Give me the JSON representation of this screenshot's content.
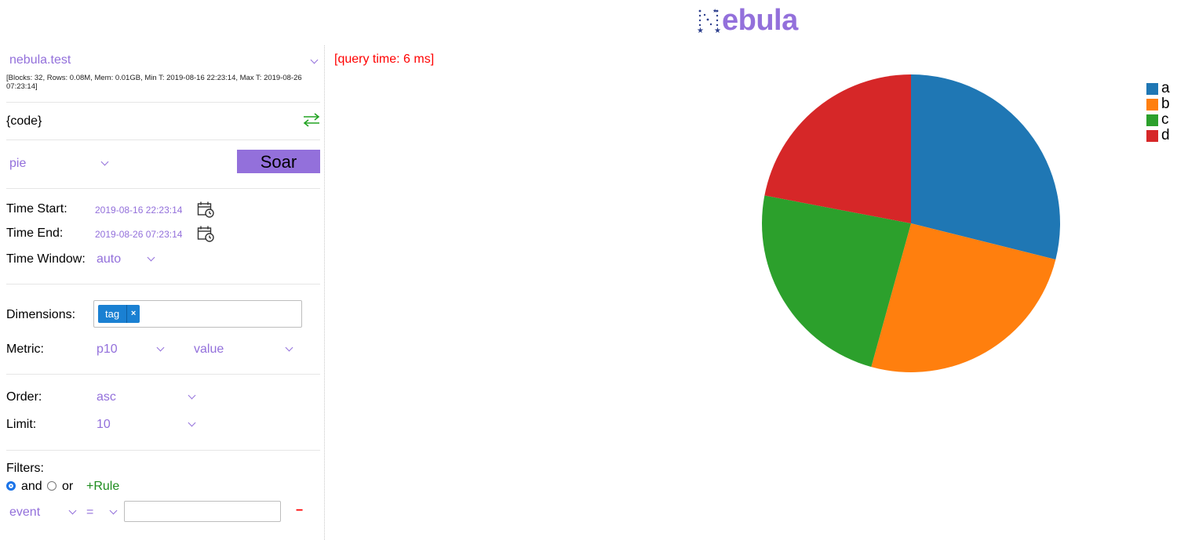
{
  "header": {
    "logo_text": "ebula",
    "logo_alt": "Nebula"
  },
  "sidebar": {
    "table": {
      "value": "nebula.test",
      "stats": "[Blocks: 32, Rows: 0.08M, Mem: 0.01GB, Min T: 2019-08-16 22:23:14, Max T: 2019-08-26 07:23:14]"
    },
    "code": {
      "label": "{code}",
      "toggle_icon": "swap-arrows-icon"
    },
    "chart_type": {
      "value": "pie"
    },
    "soar_label": "Soar",
    "time": {
      "start_label": "Time Start:",
      "start_value": "2019-08-16 22:23:14",
      "end_label": "Time End:",
      "end_value": "2019-08-26 07:23:14",
      "window_label": "Time Window:",
      "window_value": "auto"
    },
    "dimensions": {
      "label": "Dimensions:",
      "tags": [
        "tag"
      ]
    },
    "metric": {
      "label": "Metric:",
      "function": "p10",
      "field": "value"
    },
    "order": {
      "label": "Order:",
      "value": "asc"
    },
    "limit": {
      "label": "Limit:",
      "value": "10"
    },
    "filters": {
      "label": "Filters:",
      "and_label": "and",
      "or_label": "or",
      "selected": "and",
      "add_rule_label": "+Rule",
      "rule": {
        "column": "event",
        "operator": "=",
        "value": "",
        "remove_label": "−"
      }
    }
  },
  "main": {
    "query_time": "[query time: 6 ms]"
  },
  "colors": {
    "accent": "#9370db",
    "a": "#1f77b4",
    "b": "#ff7f0e",
    "c": "#2ca02c",
    "d": "#d62728"
  },
  "chart_data": {
    "type": "pie",
    "categories": [
      "a",
      "b",
      "c",
      "d"
    ],
    "values": [
      28.9,
      25.4,
      23.7,
      22.0
    ],
    "legend": "top-right"
  }
}
